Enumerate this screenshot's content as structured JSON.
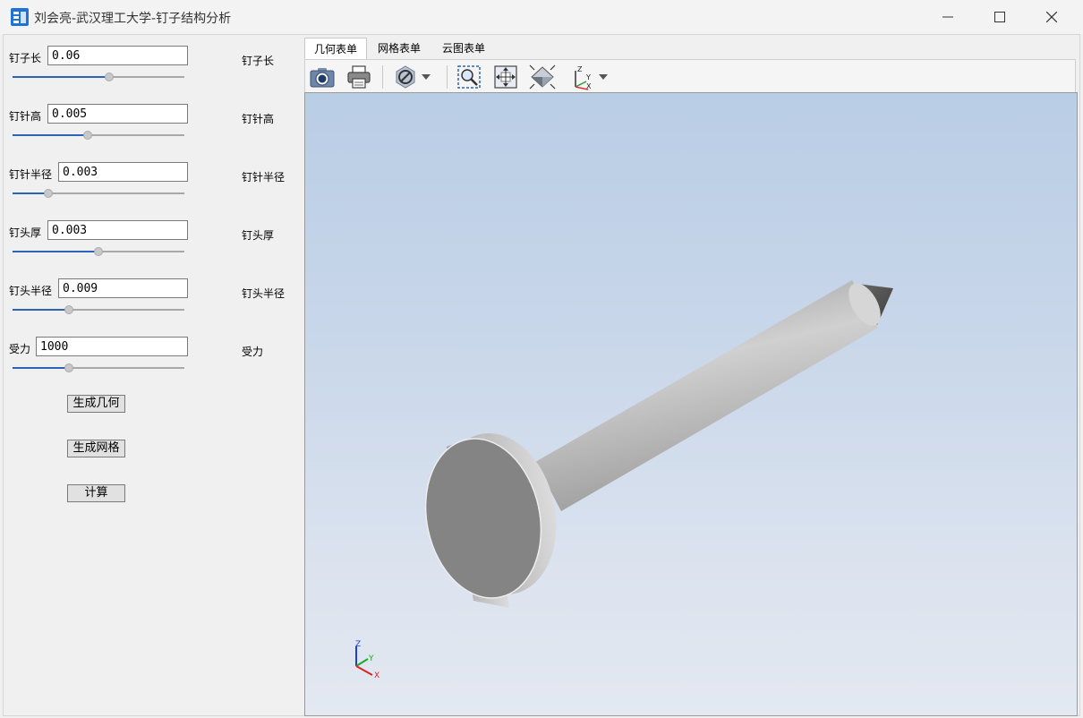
{
  "window": {
    "title": "刘会亮-武汉理工大学-钉子结构分析",
    "icon": "app-icon"
  },
  "params": [
    {
      "label": "钉子长",
      "value": "0.06",
      "echo": "钉子长",
      "slider_fraction": 0.56
    },
    {
      "label": "钉针高",
      "value": "0.005",
      "echo": "钉针高",
      "slider_fraction": 0.44
    },
    {
      "label": "钉针半径",
      "value": "0.003",
      "echo": "钉针半径",
      "slider_fraction": 0.21
    },
    {
      "label": "钉头厚",
      "value": "0.003",
      "echo": "钉头厚",
      "slider_fraction": 0.5
    },
    {
      "label": "钉头半径",
      "value": "0.009",
      "echo": "钉头半径",
      "slider_fraction": 0.33
    },
    {
      "label": "受力",
      "value": "1000",
      "echo": "受力",
      "slider_fraction": 0.33
    }
  ],
  "buttons": {
    "generate_geometry": "生成几何",
    "generate_mesh": "生成网格",
    "compute": "计算"
  },
  "tabs": [
    {
      "label": "几何表单",
      "active": true
    },
    {
      "label": "网格表单",
      "active": false
    },
    {
      "label": "云图表单",
      "active": false
    }
  ],
  "toolbar": [
    "camera-icon",
    "print-icon",
    "no-entry-icon",
    "zoom-box-icon",
    "fit-all-icon",
    "view-iso-icon",
    "axis-icon"
  ],
  "viewport": {
    "triad_labels": {
      "z": "Z",
      "y": "Y",
      "x": "X"
    },
    "background_top": "#b9cde5",
    "background_bottom": "#e3e8f1"
  },
  "colors": {
    "accent": "#2f63b5"
  }
}
